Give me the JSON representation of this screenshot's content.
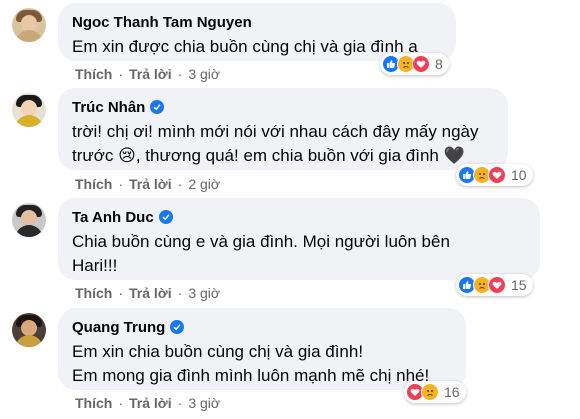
{
  "comments": [
    {
      "author": "Ngoc Thanh Tam Nguyen",
      "verified": false,
      "lines": [
        "Em xin được chia buồn cùng chị và gia đình ạ"
      ],
      "like_label": "Thích",
      "reply_label": "Trả lời",
      "time": "3 giờ",
      "reactions": [
        "like",
        "sad",
        "love"
      ],
      "reaction_count": "8"
    },
    {
      "author": "Trúc Nhân",
      "verified": true,
      "lines": [
        "trời! chị ơi! mình mới nói với nhau cách đây mấy ngày",
        "trước 😢, thương quá! em chia buồn với gia đình 🖤"
      ],
      "like_label": "Thích",
      "reply_label": "Trả lời",
      "time": "2 giờ",
      "reactions": [
        "like",
        "sad",
        "love"
      ],
      "reaction_count": "10"
    },
    {
      "author": "Ta Anh Duc",
      "verified": true,
      "lines": [
        "Chia buồn cùng e và gia đình. Mọi người luôn bên",
        "Hari!!!"
      ],
      "like_label": "Thích",
      "reply_label": "Trả lời",
      "time": "3 giờ",
      "reactions": [
        "like",
        "sad",
        "love"
      ],
      "reaction_count": "15"
    },
    {
      "author": "Quang Trung",
      "verified": true,
      "lines": [
        "Em xin chia buồn cùng chị và gia đình!",
        "Em mong gia đình mình luôn mạnh mẽ chị nhé!"
      ],
      "like_label": "Thích",
      "reply_label": "Trả lời",
      "time": "3 giờ",
      "reactions": [
        "love",
        "sad"
      ],
      "reaction_count": "16"
    }
  ],
  "separator": "·",
  "colors": {
    "bubble": "#f0f2f5",
    "meta_text": "#65676b",
    "verified": "#1877f2",
    "like": "#1877f2",
    "sad": "#f7b125",
    "love": "#f33e58"
  }
}
